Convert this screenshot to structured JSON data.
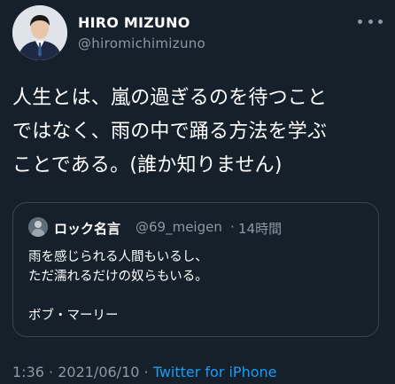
{
  "author": {
    "name": "HIRO MIZUNO",
    "handle": "@hiromichimizuno",
    "avatar_icon": "profile-photo"
  },
  "tweet": {
    "text": "人生とは、嵐の過ぎるのを待つこと\nではなく、雨の中で踊る方法を学ぶ\nことである。(誰か知りません)"
  },
  "quoted": {
    "name": "ロック名言",
    "handle": "@69_meigen",
    "separator": "·",
    "time": "14時間",
    "text": "雨を感じられる人間もいるし、\nただ濡れるだけの奴らもいる。\n\nボブ・マーリー"
  },
  "meta": {
    "time": "1:36",
    "separator": " · ",
    "date": "2021/06/10",
    "separator2": " · ",
    "source": "Twitter for iPhone"
  },
  "colors": {
    "background": "#15202b",
    "secondary_text": "#8b98a5",
    "link": "#1d9bf0",
    "border": "#38444d"
  }
}
